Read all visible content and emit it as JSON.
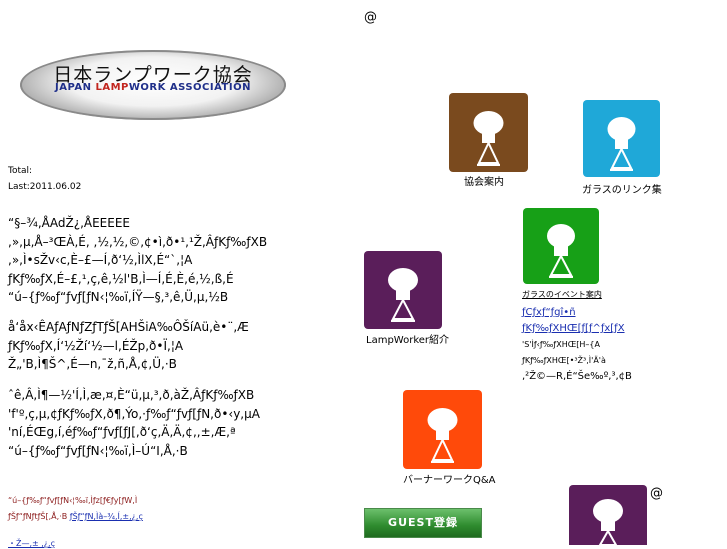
{
  "top": {
    "at_mark": "@",
    "at_mark_2": "@"
  },
  "logo": {
    "jp": "日本ランプワーク協会",
    "en_part1": "JAPAN ",
    "en_part2": "LAMP",
    "en_part3": "WORK ",
    "en_part4": "ASSOCIATION"
  },
  "counter": {
    "total_label": "Total:",
    "last_label": "Last:2011.06.02"
  },
  "paragraphs": [
    [
      "“§–¾,ÅAdŽ¿,ÅEEEEE",
      ",»,µ,Å–³ŒÀ,É, ,½,½,©,¢•ì,ð•¹,¹Ž,ÂƒKƒ‰ƒXB",
      ",»,Ì•sŽv‹c,È–£—Í,ð‘½,ÌlX,É“`,¦A",
      "ƒKƒ‰ƒX,É–£,¹,ç,ê,½l'B,Ì—Í,É,È,é,½,ß,É",
      "“ú–{ƒ‰ƒ“ƒvƒ[ƒN‹¦‰ï,ÍŸ—§,³,ê,Ü,µ,½B"
    ],
    [
      "å‘åx‹ÊAƒAƒNƒZƒTƒŠ[AHŠiA‰ÔŠíAü,è•¨,Æ",
      "ƒKƒ‰ƒX,Í‘½Ží‘½—l,ÉŽp,ð•Ï,¦A",
      "Ž„'B,Ì¶Š^,É—n,¯ž,ñ,Å,¢,Ü,·B"
    ],
    [
      "ˆê,Â,Ì¶—½'Í,Ì,æ,¤,È“ü,µ,³,ð,àŽ,ÂƒKƒ‰ƒXB",
      "'f'º,ç,µ,¢ƒKƒ‰ƒX,ð¶,Ýo,·ƒ‰ƒ“ƒvƒ[ƒN,ð•‹y,µA",
      "'ní,ÉŒg,í,éƒ‰ƒ“ƒvƒ[ƒJ[,ð‘ç,Ä,Ä,¢,,±,Æ,ª",
      "“ú–{ƒ‰ƒ“ƒvƒ[ƒN‹¦‰ï,Ì–Ú“I,Å,·B"
    ]
  ],
  "footer_red": "“ú–{ƒ‰ƒ“ƒvƒ[ƒN‹¦‰ï,Ìƒz[ƒ€ƒy[ƒW,Ì",
  "footer_line2_text": "ƒŠƒ“ƒNƒtƒŠ[,Å,·B",
  "footer_line2_link": "ƒŠƒ“ƒN,Ìà–¾,Í,±,¿,ç",
  "footer_line3": "・Ž—,± ,¿,ç",
  "tiles": {
    "assoc": {
      "label": "協会案内",
      "bg": "#7a4a1e"
    },
    "links": {
      "label": "ガラスのリンク集",
      "bg": "#1fa8d8"
    },
    "events": {
      "label": "ガラスのイベント案内",
      "bg": "#17a017"
    },
    "lampworker": {
      "label": "LampWorker紹介",
      "bg": "#5a1e5a"
    },
    "burner": {
      "label": "バーナーワークQ&A",
      "bg": "#ff4a0a"
    },
    "bottom": {
      "label": "",
      "bg": "#5a1e5a"
    }
  },
  "right_links": {
    "link1": "ƒCƒxƒ“ƒgî•ñ",
    "link2": "ƒKƒ‰ƒXHŒ[ƒ[ƒ^ƒx[ƒX",
    "line3": "'S'Ìƒ‹ƒ‰ƒXHŒ[H–{A",
    "line4": "ƒKƒ‰ƒXHŒ[•³Ž³,Ì'Ä'à",
    "line5": ",²Ž©—R,É“Še‰º,³,¢B"
  },
  "guest_button": "GUEST登録",
  "colors": {
    "link": "#1a2fb0",
    "footer_red": "#8b1a1a"
  }
}
